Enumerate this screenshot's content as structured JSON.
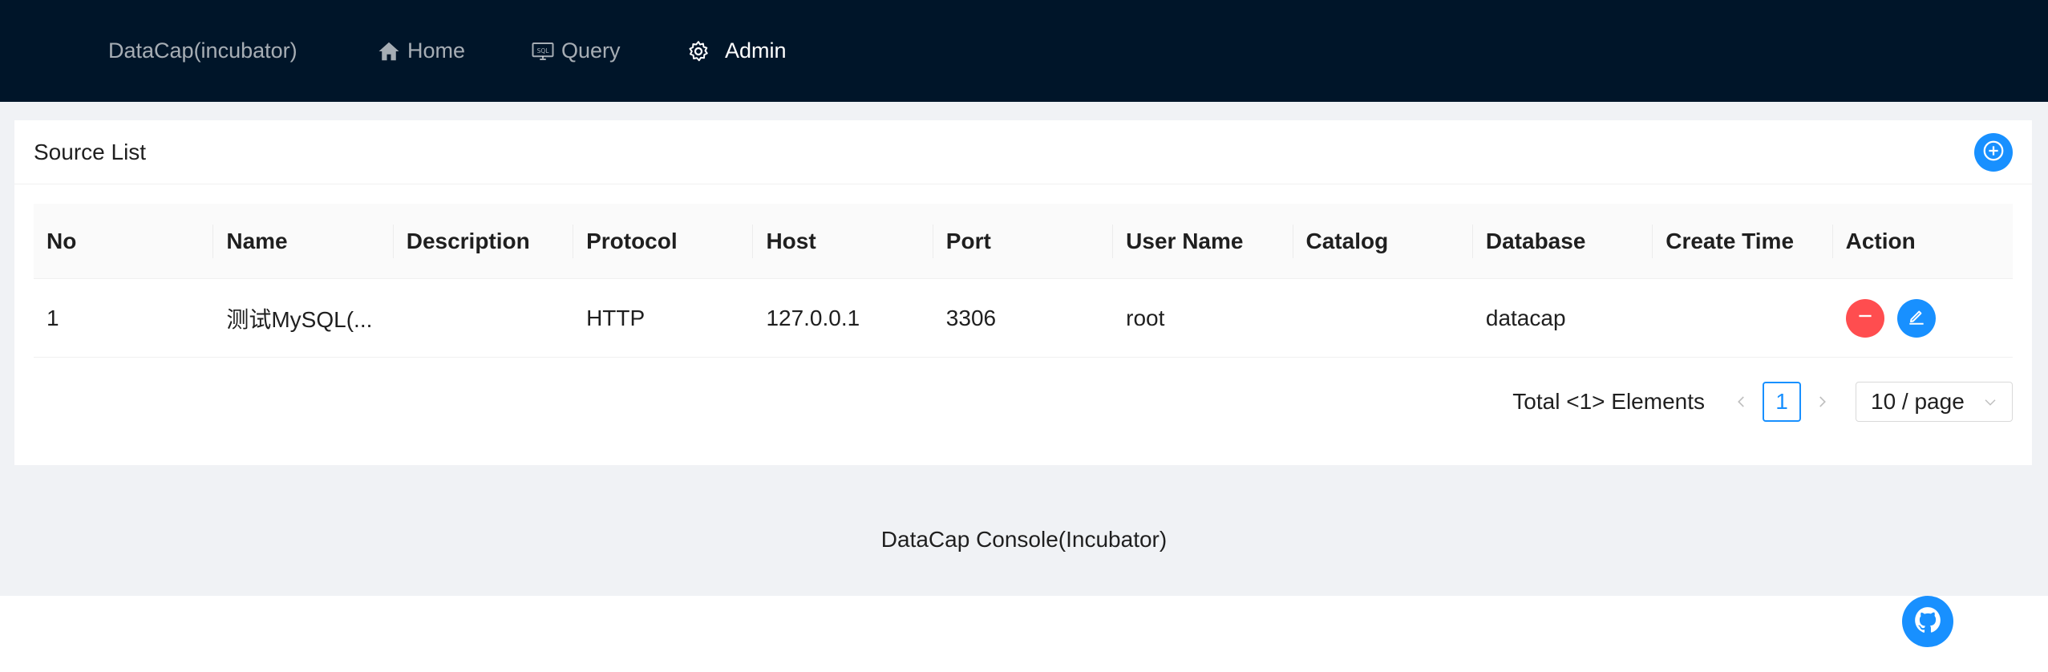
{
  "header": {
    "brand": "DataCap(incubator)",
    "nav": [
      {
        "label": "Home",
        "icon": "home-icon"
      },
      {
        "label": "Query",
        "icon": "sql-monitor-icon"
      },
      {
        "label": "Admin",
        "icon": "gear-icon",
        "active": true
      }
    ]
  },
  "card": {
    "title": "Source List",
    "add_icon": "plus-circle-icon"
  },
  "table": {
    "columns": [
      "No",
      "Name",
      "Description",
      "Protocol",
      "Host",
      "Port",
      "User Name",
      "Catalog",
      "Database",
      "Create Time",
      "Action"
    ],
    "rows": [
      {
        "no": "1",
        "name": "测试MySQL(...",
        "description": "",
        "protocol": "HTTP",
        "host": "127.0.0.1",
        "port": "3306",
        "username": "root",
        "catalog": "",
        "database": "datacap",
        "create_time": ""
      }
    ]
  },
  "pagination": {
    "total": "Total <1> Elements",
    "current_page": "1",
    "page_size": "10 / page"
  },
  "footer": {
    "text": "DataCap Console(Incubator)"
  },
  "colors": {
    "header_bg": "#001529",
    "primary": "#1890ff",
    "danger": "#ff4d4f",
    "content_bg": "#f0f2f5"
  }
}
